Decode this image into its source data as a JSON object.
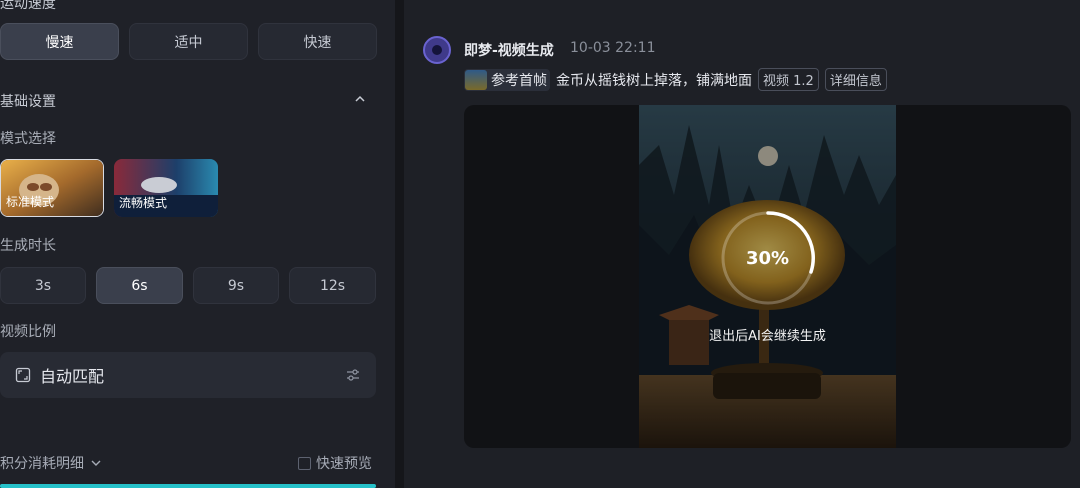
{
  "left_panel": {
    "speed_title": "运动速度",
    "speed_options": [
      "慢速",
      "适中",
      "快速"
    ],
    "basic_settings_title": "基础设置",
    "mode_title": "模式选择",
    "modes": [
      "标准模式",
      "流畅模式"
    ],
    "duration_title": "生成时长",
    "durations": [
      "3s",
      "6s",
      "9s",
      "12s"
    ],
    "ratio_title": "视频比例",
    "ratio_value": "自动匹配",
    "credits_label": "积分消耗明细",
    "fast_preview_label": "快速预览"
  },
  "message": {
    "title": "即梦-视频生成",
    "time": "10-03  22:11",
    "reference_label": "参考首帧",
    "prompt": "金币从摇钱树上掉落，铺满地面",
    "model_tag": "视频 1.2",
    "details_tag": "详细信息",
    "progress_text": "30%",
    "progress": 0.3,
    "notice": "退出后AI会继续生成"
  },
  "colors": {
    "accent": "#26c1c9",
    "avatar": "#6a63d0"
  }
}
